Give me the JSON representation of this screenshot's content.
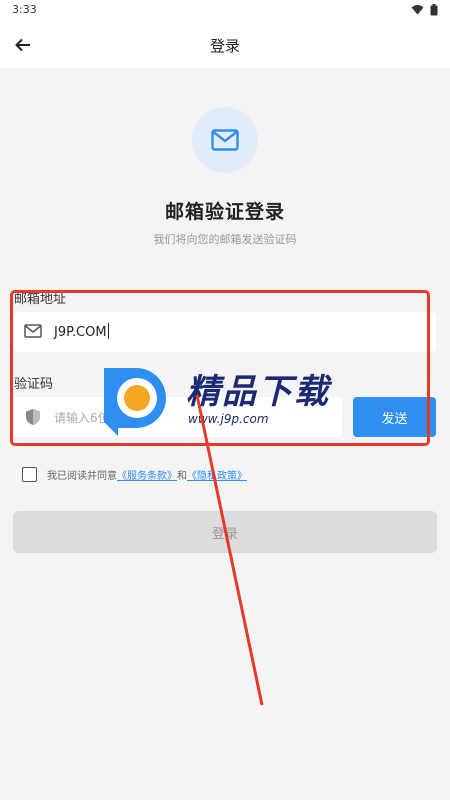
{
  "status_bar": {
    "time": "3:33"
  },
  "app_bar": {
    "title": "登录"
  },
  "header": {
    "title": "邮箱验证登录",
    "subtitle": "我们将向您的邮箱发送验证码"
  },
  "email": {
    "label": "邮箱地址",
    "value": "J9P.COM"
  },
  "code": {
    "label": "验证码",
    "placeholder": "请输入6位验证码",
    "send_label": "发送"
  },
  "agreement": {
    "prefix": "我已阅读并同意",
    "terms_link": "《服务条款》",
    "and": "和",
    "privacy_link": "《隐私政策》"
  },
  "login_button": {
    "label": "登录"
  },
  "watermark": {
    "brand": "精品下载",
    "url": "www.j9p.com"
  },
  "colors": {
    "accent": "#2f8ef2",
    "highlight": "#e53a2a",
    "disabled": "#dcdcdc"
  }
}
